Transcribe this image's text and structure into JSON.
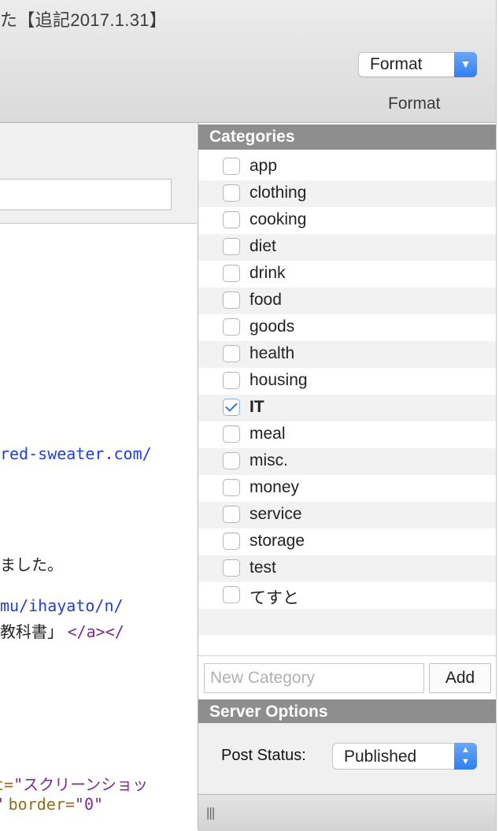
{
  "window": {
    "title_fragment": "た【追記2017.1.31】"
  },
  "toolbar": {
    "format_select_value": "Format",
    "format_caption": "Format"
  },
  "editor": {
    "lines": [
      {
        "text": "red-sweater.com/"
      },
      {
        "text": "ました。"
      },
      {
        "text": "mu/ihayato/n/"
      },
      {
        "text_jp": "教科書」",
        "text_tag": "</a></"
      },
      {
        "text_attr": "t=",
        "text_value": "\"スクリーンショッ"
      },
      {
        "text_quote": "\"",
        "text_attr": "border=",
        "text_value": "\"0\""
      }
    ]
  },
  "categories": {
    "header": "Categories",
    "items": [
      {
        "label": "app",
        "checked": false
      },
      {
        "label": "clothing",
        "checked": false
      },
      {
        "label": "cooking",
        "checked": false
      },
      {
        "label": "diet",
        "checked": false
      },
      {
        "label": "drink",
        "checked": false
      },
      {
        "label": "food",
        "checked": false
      },
      {
        "label": "goods",
        "checked": false
      },
      {
        "label": "health",
        "checked": false
      },
      {
        "label": "housing",
        "checked": false
      },
      {
        "label": "IT",
        "checked": true
      },
      {
        "label": "meal",
        "checked": false
      },
      {
        "label": "misc.",
        "checked": false
      },
      {
        "label": "money",
        "checked": false
      },
      {
        "label": "service",
        "checked": false
      },
      {
        "label": "storage",
        "checked": false
      },
      {
        "label": "test",
        "checked": false
      },
      {
        "label": "てすと",
        "checked": false
      }
    ],
    "new_category_placeholder": "New Category",
    "add_button": "Add"
  },
  "server_options": {
    "header": "Server Options",
    "post_status_label": "Post Status:",
    "post_status_value": "Published"
  },
  "colors": {
    "accent": "#2f7ff0",
    "section_header": "#8e8e8e",
    "link_blue": "#1f3fd6",
    "tag_purple": "#7b2c8f"
  }
}
